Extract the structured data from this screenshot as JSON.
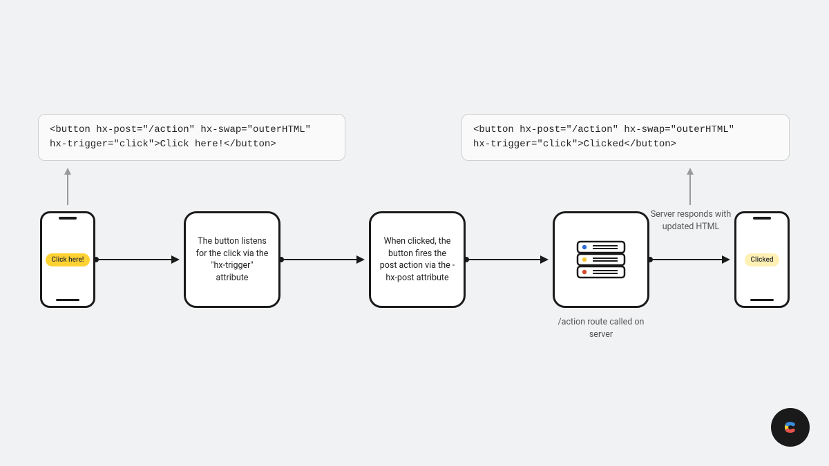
{
  "code_left": "<button hx-post=\"/action\" hx-swap=\"outerHTML\"\nhx-trigger=\"click\">Click here!</button>",
  "code_right": "<button hx-post=\"/action\" hx-swap=\"outerHTML\"\nhx-trigger=\"click\">Clicked</button>",
  "phone_left_label": "Click here!",
  "phone_right_label": "Clicked",
  "step1": "The button listens for the click via the \"hx-trigger\" attribute",
  "step2": "When clicked, the button fires the post action via the -hx-post attribute",
  "server_caption": "/action route called on server",
  "response_caption": "Server responds with updated HTML"
}
